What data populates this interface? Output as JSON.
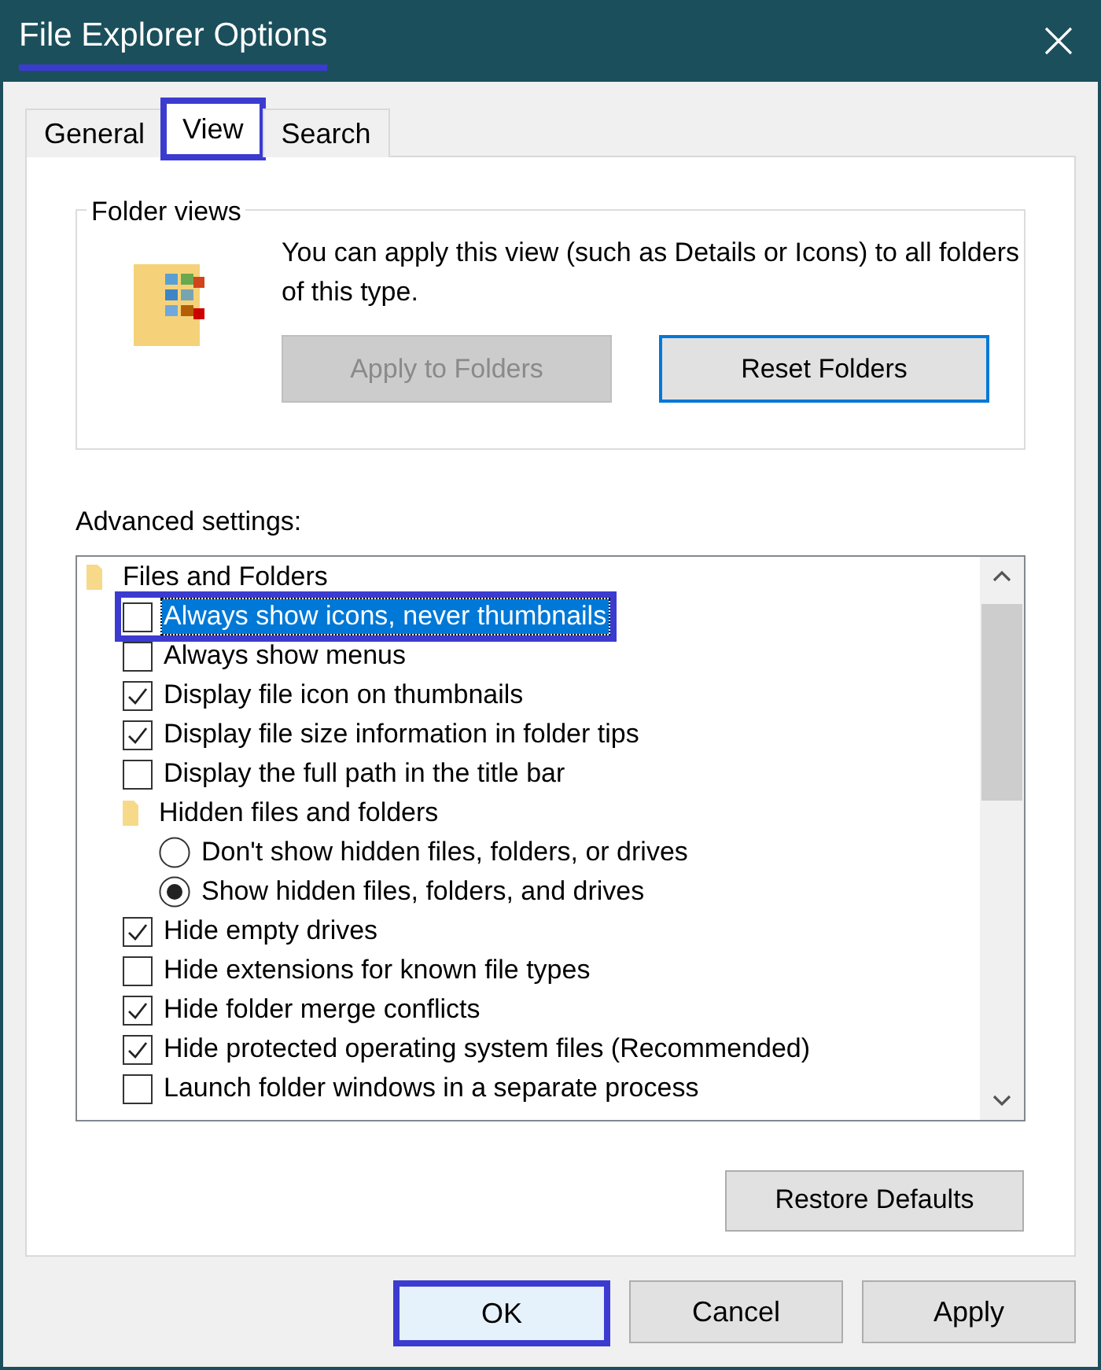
{
  "window": {
    "title": "File Explorer Options",
    "title_highlighted": true
  },
  "tabs": [
    {
      "label": "General",
      "selected": false,
      "highlighted": false
    },
    {
      "label": "View",
      "selected": true,
      "highlighted": true
    },
    {
      "label": "Search",
      "selected": false,
      "highlighted": false
    }
  ],
  "folder_views": {
    "title": "Folder views",
    "description": "You can apply this view (such as Details or Icons) to all folders of this type.",
    "buttons": [
      {
        "label": "Apply to Folders",
        "disabled": true,
        "focused": false
      },
      {
        "label": "Reset Folders",
        "disabled": false,
        "focused": true
      }
    ]
  },
  "advanced_settings": {
    "label": "Advanced settings:",
    "tree": [
      {
        "kind": "folder",
        "label": "Files and Folders",
        "children": [
          {
            "kind": "checkbox",
            "label": "Always show icons, never thumbnails",
            "checked": false,
            "selected": true,
            "highlighted": true
          },
          {
            "kind": "checkbox",
            "label": "Always show menus",
            "checked": false,
            "selected": false,
            "highlighted": false
          },
          {
            "kind": "checkbox",
            "label": "Display file icon on thumbnails",
            "checked": true,
            "selected": false,
            "highlighted": false
          },
          {
            "kind": "checkbox",
            "label": "Display file size information in folder tips",
            "checked": true,
            "selected": false,
            "highlighted": false
          },
          {
            "kind": "checkbox",
            "label": "Display the full path in the title bar",
            "checked": false,
            "selected": false,
            "highlighted": false
          },
          {
            "kind": "folder",
            "label": "Hidden files and folders",
            "children": [
              {
                "kind": "radio",
                "label": "Don't show hidden files, folders, or drives",
                "checked": false,
                "selected": false,
                "highlighted": false
              },
              {
                "kind": "radio",
                "label": "Show hidden files, folders, and drives",
                "checked": true,
                "selected": false,
                "highlighted": false
              }
            ]
          },
          {
            "kind": "checkbox",
            "label": "Hide empty drives",
            "checked": true,
            "selected": false,
            "highlighted": false
          },
          {
            "kind": "checkbox",
            "label": "Hide extensions for known file types",
            "checked": false,
            "selected": false,
            "highlighted": false
          },
          {
            "kind": "checkbox",
            "label": "Hide folder merge conflicts",
            "checked": true,
            "selected": false,
            "highlighted": false
          },
          {
            "kind": "checkbox",
            "label": "Hide protected operating system files (Recommended)",
            "checked": true,
            "selected": false,
            "highlighted": false
          },
          {
            "kind": "checkbox",
            "label": "Launch folder windows in a separate process",
            "checked": false,
            "selected": false,
            "highlighted": false
          }
        ]
      }
    ],
    "restore_button": "Restore Defaults"
  },
  "buttons": [
    {
      "label": "OK",
      "highlighted": true
    },
    {
      "label": "Cancel",
      "highlighted": false
    },
    {
      "label": "Apply",
      "highlighted": false
    }
  ]
}
